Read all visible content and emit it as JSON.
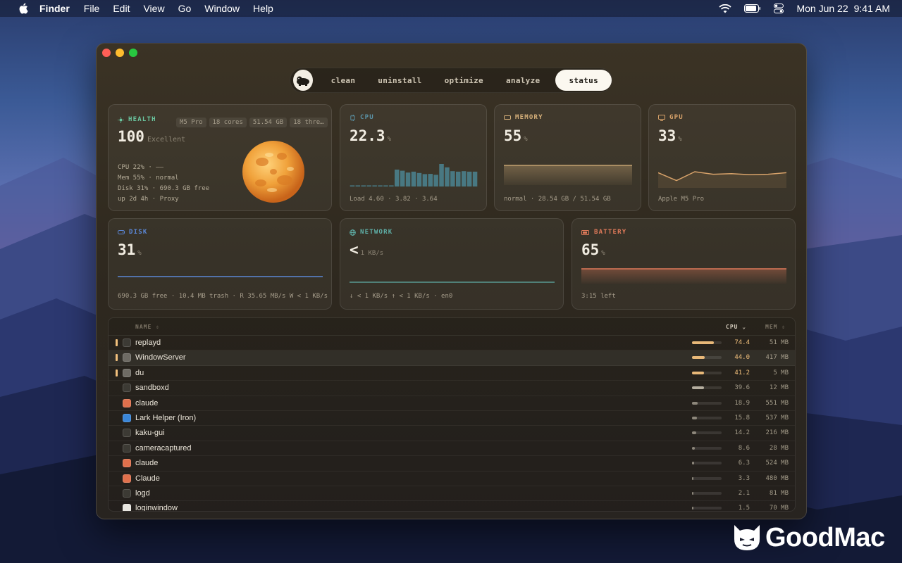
{
  "menubar": {
    "app": "Finder",
    "items": [
      "File",
      "Edit",
      "View",
      "Go",
      "Window",
      "Help"
    ],
    "date": "Mon Jun 22",
    "time": "9:41 AM"
  },
  "nav": {
    "tabs": [
      "clean",
      "uninstall",
      "optimize",
      "analyze",
      "status"
    ],
    "active": "status"
  },
  "health": {
    "title": "HEALTH",
    "chips": [
      "M5 Pro",
      "18 cores",
      "51.54 GB",
      "18 thre…"
    ],
    "score": "100",
    "rating": "Excellent",
    "lines": [
      "CPU 22% · ——",
      "Mem 55% · normal",
      "Disk 31% · 690.3 GB free",
      "up 2d 4h · Proxy"
    ]
  },
  "cpu": {
    "title": "CPU",
    "value": "22.3",
    "unit": "%",
    "foot": "Load 4.60 · 3.82 · 3.64",
    "bars": [
      0.05,
      0.05,
      0.05,
      0.05,
      0.05,
      0.05,
      0.05,
      0.05,
      0.75,
      0.7,
      0.62,
      0.66,
      0.6,
      0.55,
      0.56,
      0.52,
      1.0,
      0.85,
      0.68,
      0.66,
      0.68,
      0.66,
      0.66
    ],
    "color": "#4e8fa0"
  },
  "memory": {
    "title": "MEMORY",
    "value": "55",
    "unit": "%",
    "foot": "normal · 28.54 GB / 51.54 GB",
    "color": "#d6b07a"
  },
  "gpu": {
    "title": "GPU",
    "value": "33",
    "unit": "%",
    "foot": "Apple M5 Pro",
    "series": [
      0.7,
      0.3,
      0.75,
      0.62,
      0.65,
      0.6,
      0.62,
      0.7
    ],
    "color": "#d9a36a"
  },
  "disk": {
    "title": "DISK",
    "value": "31",
    "unit": "%",
    "foot": "690.3 GB free · 10.4 MB trash · R 35.65 MB/s W < 1 KB/s",
    "color": "#5b87d6"
  },
  "network": {
    "title": "NETWORK",
    "value": "<",
    "unit": "1 KB/s",
    "foot": "↓ < 1 KB/s  ↑ < 1 KB/s · en0",
    "color": "#5fb0a8"
  },
  "battery": {
    "title": "BATTERY",
    "value": "65",
    "unit": "%",
    "foot": "3:15 left",
    "color": "#e07a5a"
  },
  "table": {
    "col_name": "NAME",
    "col_cpu": "CPU",
    "col_mem": "MEM",
    "rows": [
      {
        "name": "replayd",
        "cpu": "74.4",
        "mem": "51 MB",
        "frac": 0.744,
        "hot": true,
        "icon": "terminal-icon"
      },
      {
        "name": "WindowServer",
        "cpu": "44.0",
        "mem": "417 MB",
        "frac": 0.44,
        "hot": true,
        "icon": "gear-icon"
      },
      {
        "name": "du",
        "cpu": "41.2",
        "mem": "5 MB",
        "frac": 0.412,
        "hot": true,
        "icon": "gear-icon"
      },
      {
        "name": "sandboxd",
        "cpu": "39.6",
        "mem": "12 MB",
        "frac": 0.396,
        "hot": false,
        "icon": "terminal-icon"
      },
      {
        "name": "claude",
        "cpu": "18.9",
        "mem": "551 MB",
        "frac": 0.189,
        "hot": false,
        "icon": "claude-icon"
      },
      {
        "name": "Lark Helper (Iron)",
        "cpu": "15.8",
        "mem": "537 MB",
        "frac": 0.158,
        "hot": false,
        "icon": "lark-icon"
      },
      {
        "name": "kaku-gui",
        "cpu": "14.2",
        "mem": "216 MB",
        "frac": 0.142,
        "hot": false,
        "icon": "terminal-icon"
      },
      {
        "name": "cameracaptured",
        "cpu": "8.6",
        "mem": "28 MB",
        "frac": 0.086,
        "hot": false,
        "icon": "terminal-icon"
      },
      {
        "name": "claude",
        "cpu": "6.3",
        "mem": "524 MB",
        "frac": 0.063,
        "hot": false,
        "icon": "claude-icon"
      },
      {
        "name": "Claude",
        "cpu": "3.3",
        "mem": "480 MB",
        "frac": 0.033,
        "hot": false,
        "icon": "claude-icon"
      },
      {
        "name": "logd",
        "cpu": "2.1",
        "mem": "81 MB",
        "frac": 0.021,
        "hot": false,
        "icon": "terminal-icon"
      },
      {
        "name": "loginwindow",
        "cpu": "1.5",
        "mem": "70 MB",
        "frac": 0.015,
        "hot": false,
        "icon": "window-icon"
      }
    ]
  },
  "watermark": "GoodMac"
}
